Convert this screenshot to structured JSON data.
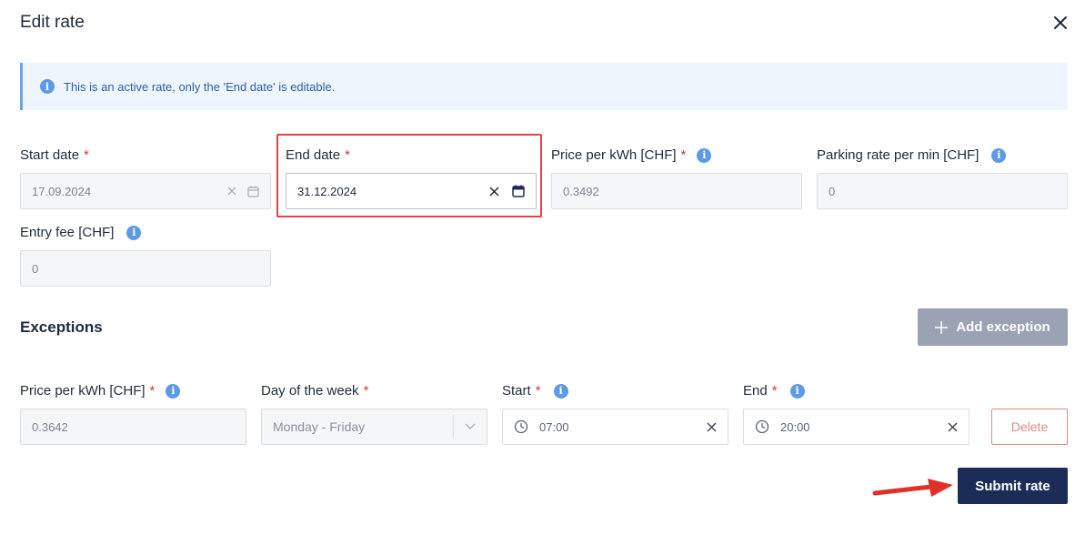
{
  "dialog": {
    "title": "Edit rate"
  },
  "banner": {
    "text": "This is an active rate, only the 'End date' is editable."
  },
  "rate": {
    "start_date": {
      "label": "Start date",
      "required": "*",
      "value": "17.09.2024"
    },
    "end_date": {
      "label": "End date",
      "required": "*",
      "value": "31.12.2024"
    },
    "price_kwh": {
      "label": "Price per kWh [CHF]",
      "required": "*",
      "value": "0.3492"
    },
    "parking_rate": {
      "label": "Parking rate per min [CHF]",
      "value": "0"
    },
    "entry_fee": {
      "label": "Entry fee [CHF]",
      "value": "0"
    }
  },
  "exceptions": {
    "title": "Exceptions",
    "add_label": "Add exception",
    "row": {
      "price": {
        "label": "Price per kWh [CHF]",
        "required": "*",
        "value": "0.3642"
      },
      "day": {
        "label": "Day of the week",
        "required": "*",
        "value": "Monday - Friday"
      },
      "start": {
        "label": "Start",
        "required": "*",
        "value": "07:00"
      },
      "end": {
        "label": "End",
        "required": "*",
        "value": "20:00"
      },
      "delete_label": "Delete"
    }
  },
  "footer": {
    "submit_label": "Submit rate"
  },
  "icons": {
    "info": "i"
  },
  "colors": {
    "primary": "#1b2d57",
    "required": "#d9333f",
    "highlight": "#e0434b",
    "info": "#5c9ae6"
  }
}
